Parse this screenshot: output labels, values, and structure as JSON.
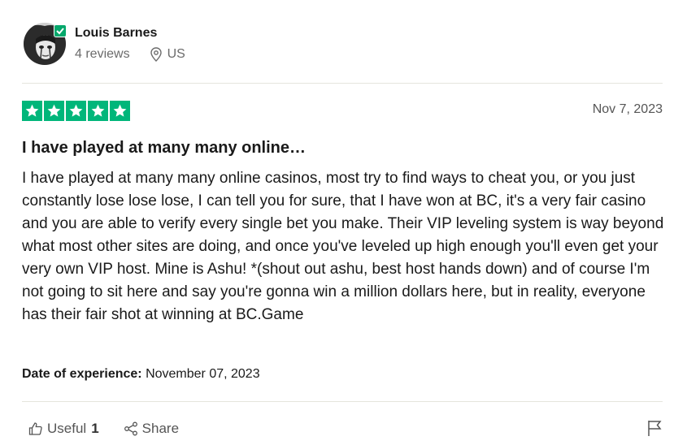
{
  "reviewer": {
    "name": "Louis Barnes",
    "reviews_count": "4 reviews",
    "country": "US",
    "verified": true
  },
  "review": {
    "rating": 5,
    "rating_max": 5,
    "date": "Nov 7, 2023",
    "title": "I have played at many many online…",
    "body": "I have played at many many online casinos, most try to find ways to cheat you, or you just constantly lose lose lose, I can tell you for sure, that I have won at BC, it's a very fair casino and you are able to verify every single bet you make. Their VIP leveling system is way beyond what most other sites are doing, and once you've leveled up high enough you'll even get your very own VIP host. Mine is Ashu! *(shout out ashu, best host hands down) and of course I'm not going to sit here and say you're gonna win a million dollars here, but in reality, everyone has their fair shot at winning at BC.Game",
    "experience_label": "Date of experience:",
    "experience_date": "November 07, 2023"
  },
  "actions": {
    "useful_label": "Useful",
    "useful_count": "1",
    "share_label": "Share"
  },
  "icons": {
    "star": "star-icon",
    "verified": "check-badge-icon",
    "location": "location-pin-icon",
    "useful": "thumbs-up-icon",
    "share": "share-icon",
    "report": "flag-icon"
  },
  "colors": {
    "star_bg": "#00b67a",
    "verified": "#04a76b",
    "muted_text": "#6b6b6b"
  }
}
